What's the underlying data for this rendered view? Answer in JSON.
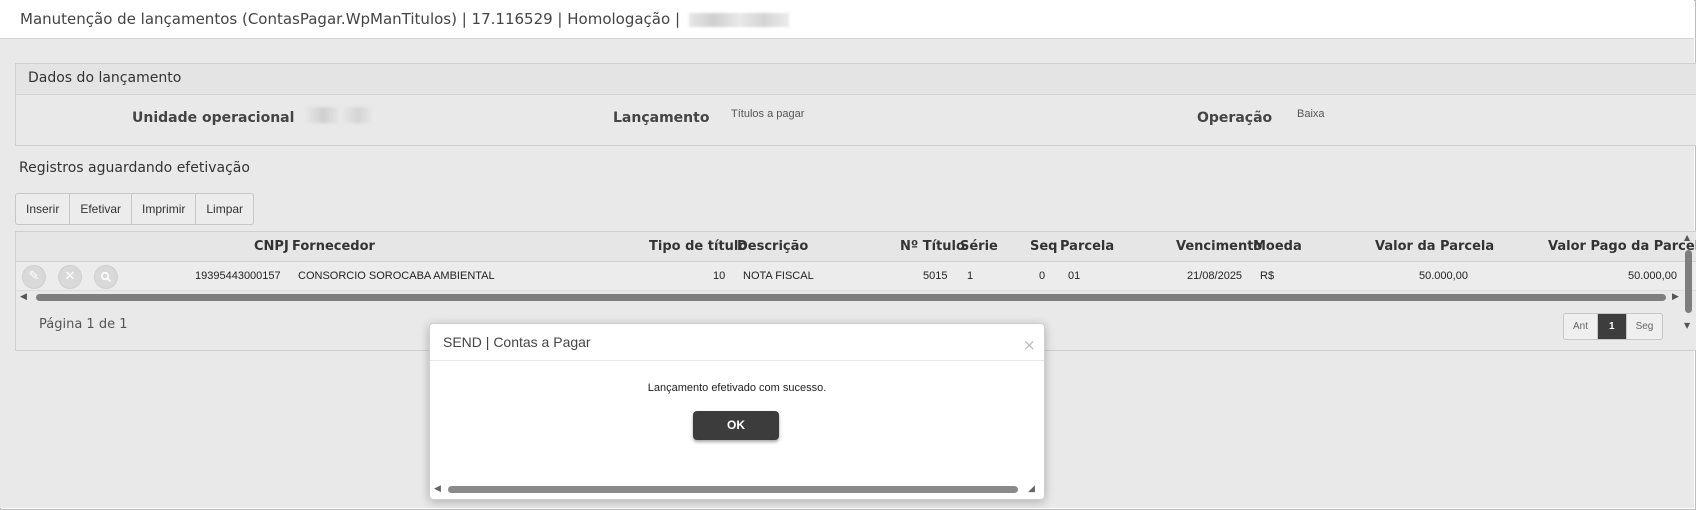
{
  "window": {
    "title": "Manutenção de lançamentos (ContasPagar.WpManTitulos) | 17.116529 | Homologação |"
  },
  "panel": {
    "title": "Dados do lançamento",
    "unidade_label": "Unidade operacional",
    "lancamento_label": "Lançamento",
    "lancamento_value": "Títulos a pagar",
    "operacao_label": "Operação",
    "operacao_value": "Baixa"
  },
  "section": {
    "title": "Registros aguardando efetivação"
  },
  "toolbar": {
    "inserir": "Inserir",
    "efetivar": "Efetivar",
    "imprimir": "Imprimir",
    "limpar": "Limpar"
  },
  "table": {
    "headers": {
      "cnpj": "CNPJ",
      "fornecedor": "Fornecedor",
      "tipo": "Tipo de título",
      "descricao": "Descrição",
      "numero": "Nº Título",
      "serie": "Série",
      "seq": "Seq",
      "parcela": "Parcela",
      "vencimento": "Vencimento",
      "moeda": "Moeda",
      "valor_parcela": "Valor da Parcela",
      "valor_pago": "Valor Pago da Parcela"
    },
    "rows": [
      {
        "cnpj": "19395443000157",
        "fornecedor": "CONSORCIO SOROCABA AMBIENTAL",
        "tipo": "10",
        "descricao": "NOTA FISCAL",
        "numero": "5015",
        "serie": "1",
        "seq": "0",
        "parcela": "01",
        "vencimento": "21/08/2025",
        "moeda": "R$",
        "valor_parcela": "50.000,00",
        "valor_pago": "50.000,00"
      }
    ]
  },
  "pager": {
    "label": "Página 1 de 1",
    "prev": "Ant",
    "current": "1",
    "next": "Seg"
  },
  "dialog": {
    "title": "SEND | Contas a Pagar",
    "close": "×",
    "message": "Lançamento efetivado com sucesso.",
    "ok": "OK"
  },
  "icons": {
    "edit": "pencil-icon",
    "delete": "close-icon",
    "view": "search-icon"
  }
}
